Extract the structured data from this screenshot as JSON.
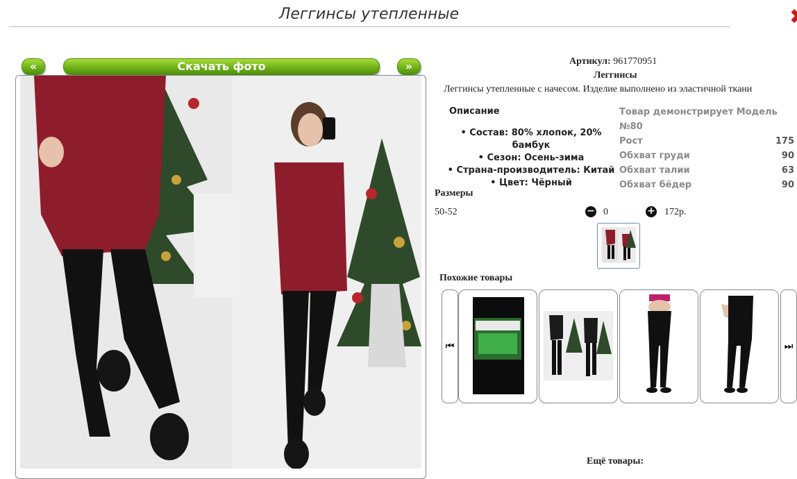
{
  "header": {
    "title": "Леггинсы утепленные"
  },
  "gallery": {
    "prev_label": "«",
    "download_label": "Скачать фото",
    "next_label": "»"
  },
  "product": {
    "article_label": "Артикул:",
    "article_value": "961770951",
    "name": "Леггинсы",
    "description": "Леггинсы утепленные с начесом. Изделие выполнено из эластичной ткани"
  },
  "details": {
    "heading": "Описание",
    "items": [
      "Состав: 80% хлопок, 20% бамбук",
      "Сезон: Осень-зима",
      "Страна-производитель: Китай",
      "Цвет: Чёрный"
    ]
  },
  "model": {
    "rows": [
      {
        "label": "Товар демонстрирует Модель №80",
        "value": ""
      },
      {
        "label": "Рост",
        "value": "175"
      },
      {
        "label": "Обхват груди",
        "value": "90"
      },
      {
        "label": "Обхват талии",
        "value": "63"
      },
      {
        "label": "Обхват бёдер",
        "value": "90"
      }
    ]
  },
  "sizes": {
    "heading": "Размеры",
    "rows": [
      {
        "name": "50-52",
        "qty": "0",
        "price": "172р."
      }
    ]
  },
  "similar": {
    "heading": "Похожие товары",
    "prev_icon": "skip-previous-icon",
    "next_icon": "skip-next-icon"
  },
  "more": {
    "heading": "Ещё товары:"
  },
  "colors": {
    "button_green": "#6fb217",
    "close_red": "#d01818",
    "dress_red": "#8e1d2c"
  }
}
